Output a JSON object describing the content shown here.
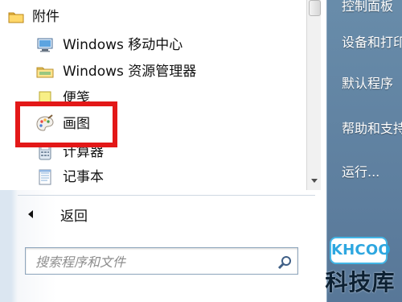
{
  "start_menu": {
    "programs": {
      "folder_label": "附件",
      "items": [
        {
          "label": "Windows 移动中心",
          "icon": "mobility-center-icon"
        },
        {
          "label": "Windows 资源管理器",
          "icon": "explorer-folder-icon"
        },
        {
          "label": "便笺",
          "icon": "sticky-notes-icon"
        },
        {
          "label": "画图",
          "icon": "paint-palette-icon"
        },
        {
          "label": "计算器",
          "icon": "calculator-icon"
        },
        {
          "label": "记事本",
          "icon": "notepad-icon"
        }
      ]
    },
    "back_label": "返回",
    "search": {
      "placeholder": "搜索程序和文件"
    },
    "right_panel": {
      "items": [
        {
          "label": "控制面板"
        },
        {
          "label": "设备和打印机"
        },
        {
          "label": "默认程序"
        },
        {
          "label": "帮助和支持"
        },
        {
          "label": "运行..."
        }
      ]
    }
  },
  "annotation": {
    "highlight_color": "#e31818"
  },
  "watermark": {
    "logo_text": "KHCOO",
    "site_text": "科技库"
  }
}
